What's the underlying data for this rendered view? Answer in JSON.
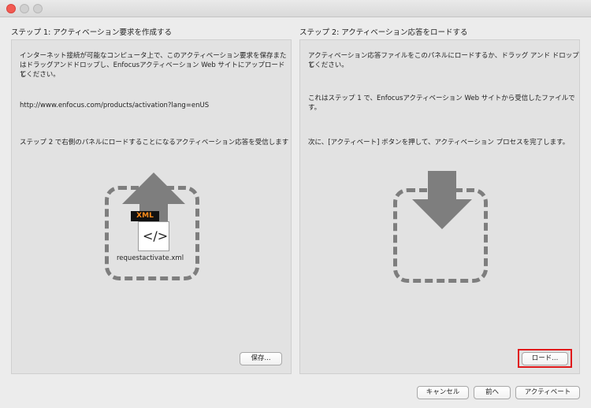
{
  "window": {
    "controls": [
      "close",
      "minimize",
      "maximize"
    ]
  },
  "step1": {
    "title": "ステップ 1: アクティベーション要求を作成する",
    "text_line1": "インターネット接続が可能なコンピュータ上で、このアクティベーション要求を保存また",
    "text_line2": "はドラッグアンドドロップし、Enfocusアクティベーション Web サイトにアップロードし",
    "text_line3": "てください。",
    "link": "http://www.enfocus.com/products/activation?lang=enUS",
    "text2": "ステップ 2 で右側のパネルにロードすることになるアクティベーション応答を受信します",
    "file_badge": "XML",
    "file_icon": "code-icon",
    "filename": "requestactivate.xml",
    "save_button": "保存..."
  },
  "step2": {
    "title": "ステップ 2: アクティベーション応答をロードする",
    "text1_line1": "アクティベーション応答ファイルをこのパネルにロードするか、ドラッグ アンド ドロップし",
    "text1_line2": "てください。",
    "text2_line1": "これはステップ 1 で、Enfocusアクティベーション Web サイトから受信したファイルで",
    "text2_line2": "す。",
    "text3": "次に、[アクティベート] ボタンを押して、アクティベーション プロセスを完了します。",
    "load_button": "ロード...",
    "highlight_color": "#e0191b"
  },
  "footer": {
    "cancel_button": "キャンセル",
    "back_button": "前へ",
    "activate_button": "アクティベート"
  }
}
